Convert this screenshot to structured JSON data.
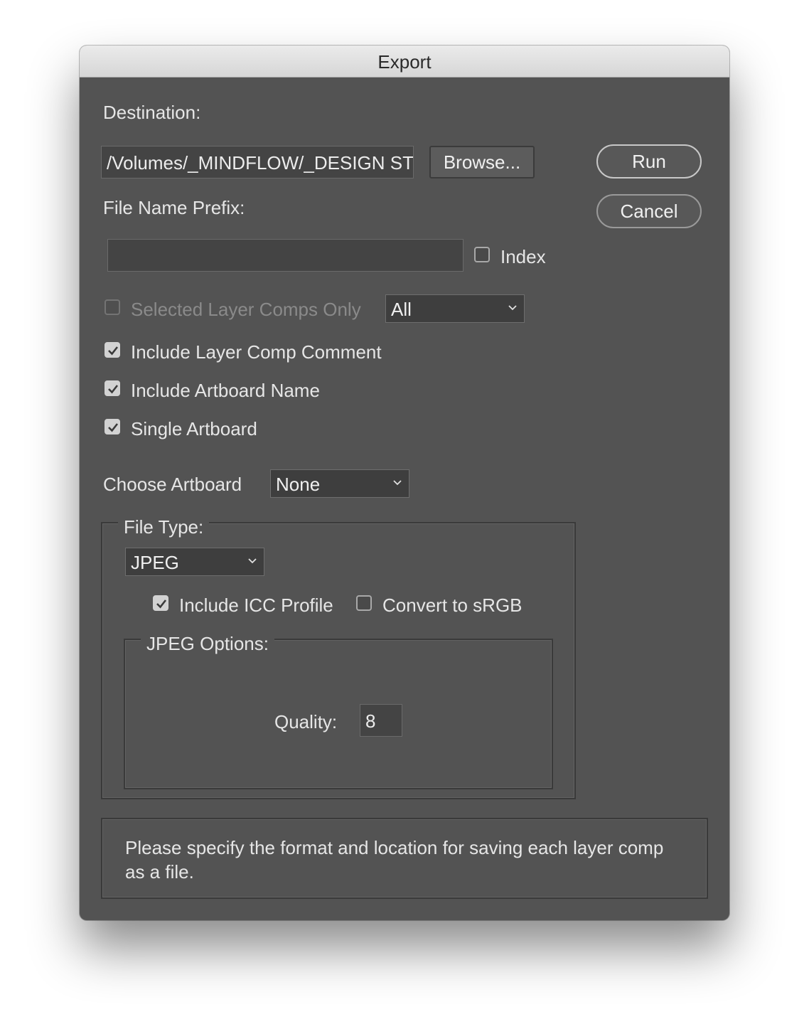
{
  "window": {
    "title": "Export"
  },
  "destination": {
    "label": "Destination:",
    "path_value": "/Volumes/_MINDFLOW/_DESIGN ST",
    "browse_label": "Browse..."
  },
  "actions": {
    "run_label": "Run",
    "cancel_label": "Cancel"
  },
  "prefix": {
    "label": "File Name Prefix:",
    "value": "",
    "index_label": "Index",
    "index_checked": false
  },
  "layer_comps": {
    "selected_only_label": "Selected Layer Comps Only",
    "selected_only_checked": false,
    "selected_only_enabled": false,
    "scope_value": "All"
  },
  "options": {
    "include_comment_label": "Include Layer Comp Comment",
    "include_comment_checked": true,
    "include_artboard_name_label": "Include Artboard Name",
    "include_artboard_name_checked": true,
    "single_artboard_label": "Single Artboard",
    "single_artboard_checked": true
  },
  "artboard": {
    "label": "Choose Artboard",
    "value": "None"
  },
  "file_type": {
    "legend": "File Type:",
    "value": "JPEG",
    "icc_label": "Include ICC Profile",
    "icc_checked": true,
    "srgb_label": "Convert to sRGB",
    "srgb_checked": false
  },
  "jpeg_options": {
    "legend": "JPEG Options:",
    "quality_label": "Quality:",
    "quality_value": "8"
  },
  "info": {
    "text": "Please specify the format and location for saving each layer comp as a file."
  },
  "icons": {
    "checkmark": "checkmark-icon",
    "dropdown": "chevron-down-icon"
  },
  "colors": {
    "panel_background": "#535353",
    "titlebar": "#e2e2e2",
    "text": "#e6e6e6",
    "disabled_text": "#8a8a8a"
  }
}
